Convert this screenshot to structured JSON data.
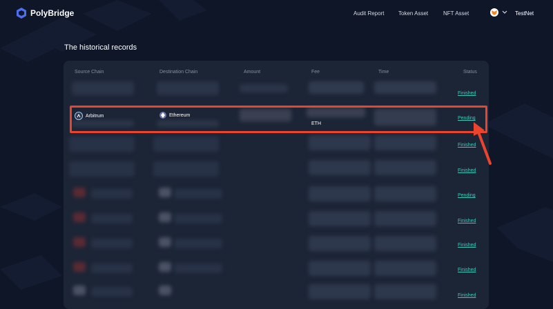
{
  "brand": {
    "name": "PolyBridge"
  },
  "nav": {
    "audit_report": "Audit Report",
    "token_asset": "Token Asset",
    "nft_asset": "NFT Asset"
  },
  "wallet": {
    "network": "TestNet",
    "icon": "fox-icon"
  },
  "page": {
    "title": "The historical records"
  },
  "table": {
    "headers": [
      "Source Chain",
      "Destination Chain",
      "Amount",
      "Fee",
      "Time",
      "Status"
    ],
    "highlighted_row": {
      "source_chain": "Arbitrum",
      "destination_chain": "Ethereum",
      "fee_token": "ETH",
      "status": "Pending"
    },
    "statuses": [
      "Finished",
      "Pending",
      "Finished",
      "Finished",
      "Pending",
      "Finished",
      "Finished",
      "Finished",
      "Finished"
    ]
  },
  "colors": {
    "background": "#0f1628",
    "card": "#1c2536",
    "status_link": "#3ec8b9",
    "highlight": "#e8442e"
  }
}
